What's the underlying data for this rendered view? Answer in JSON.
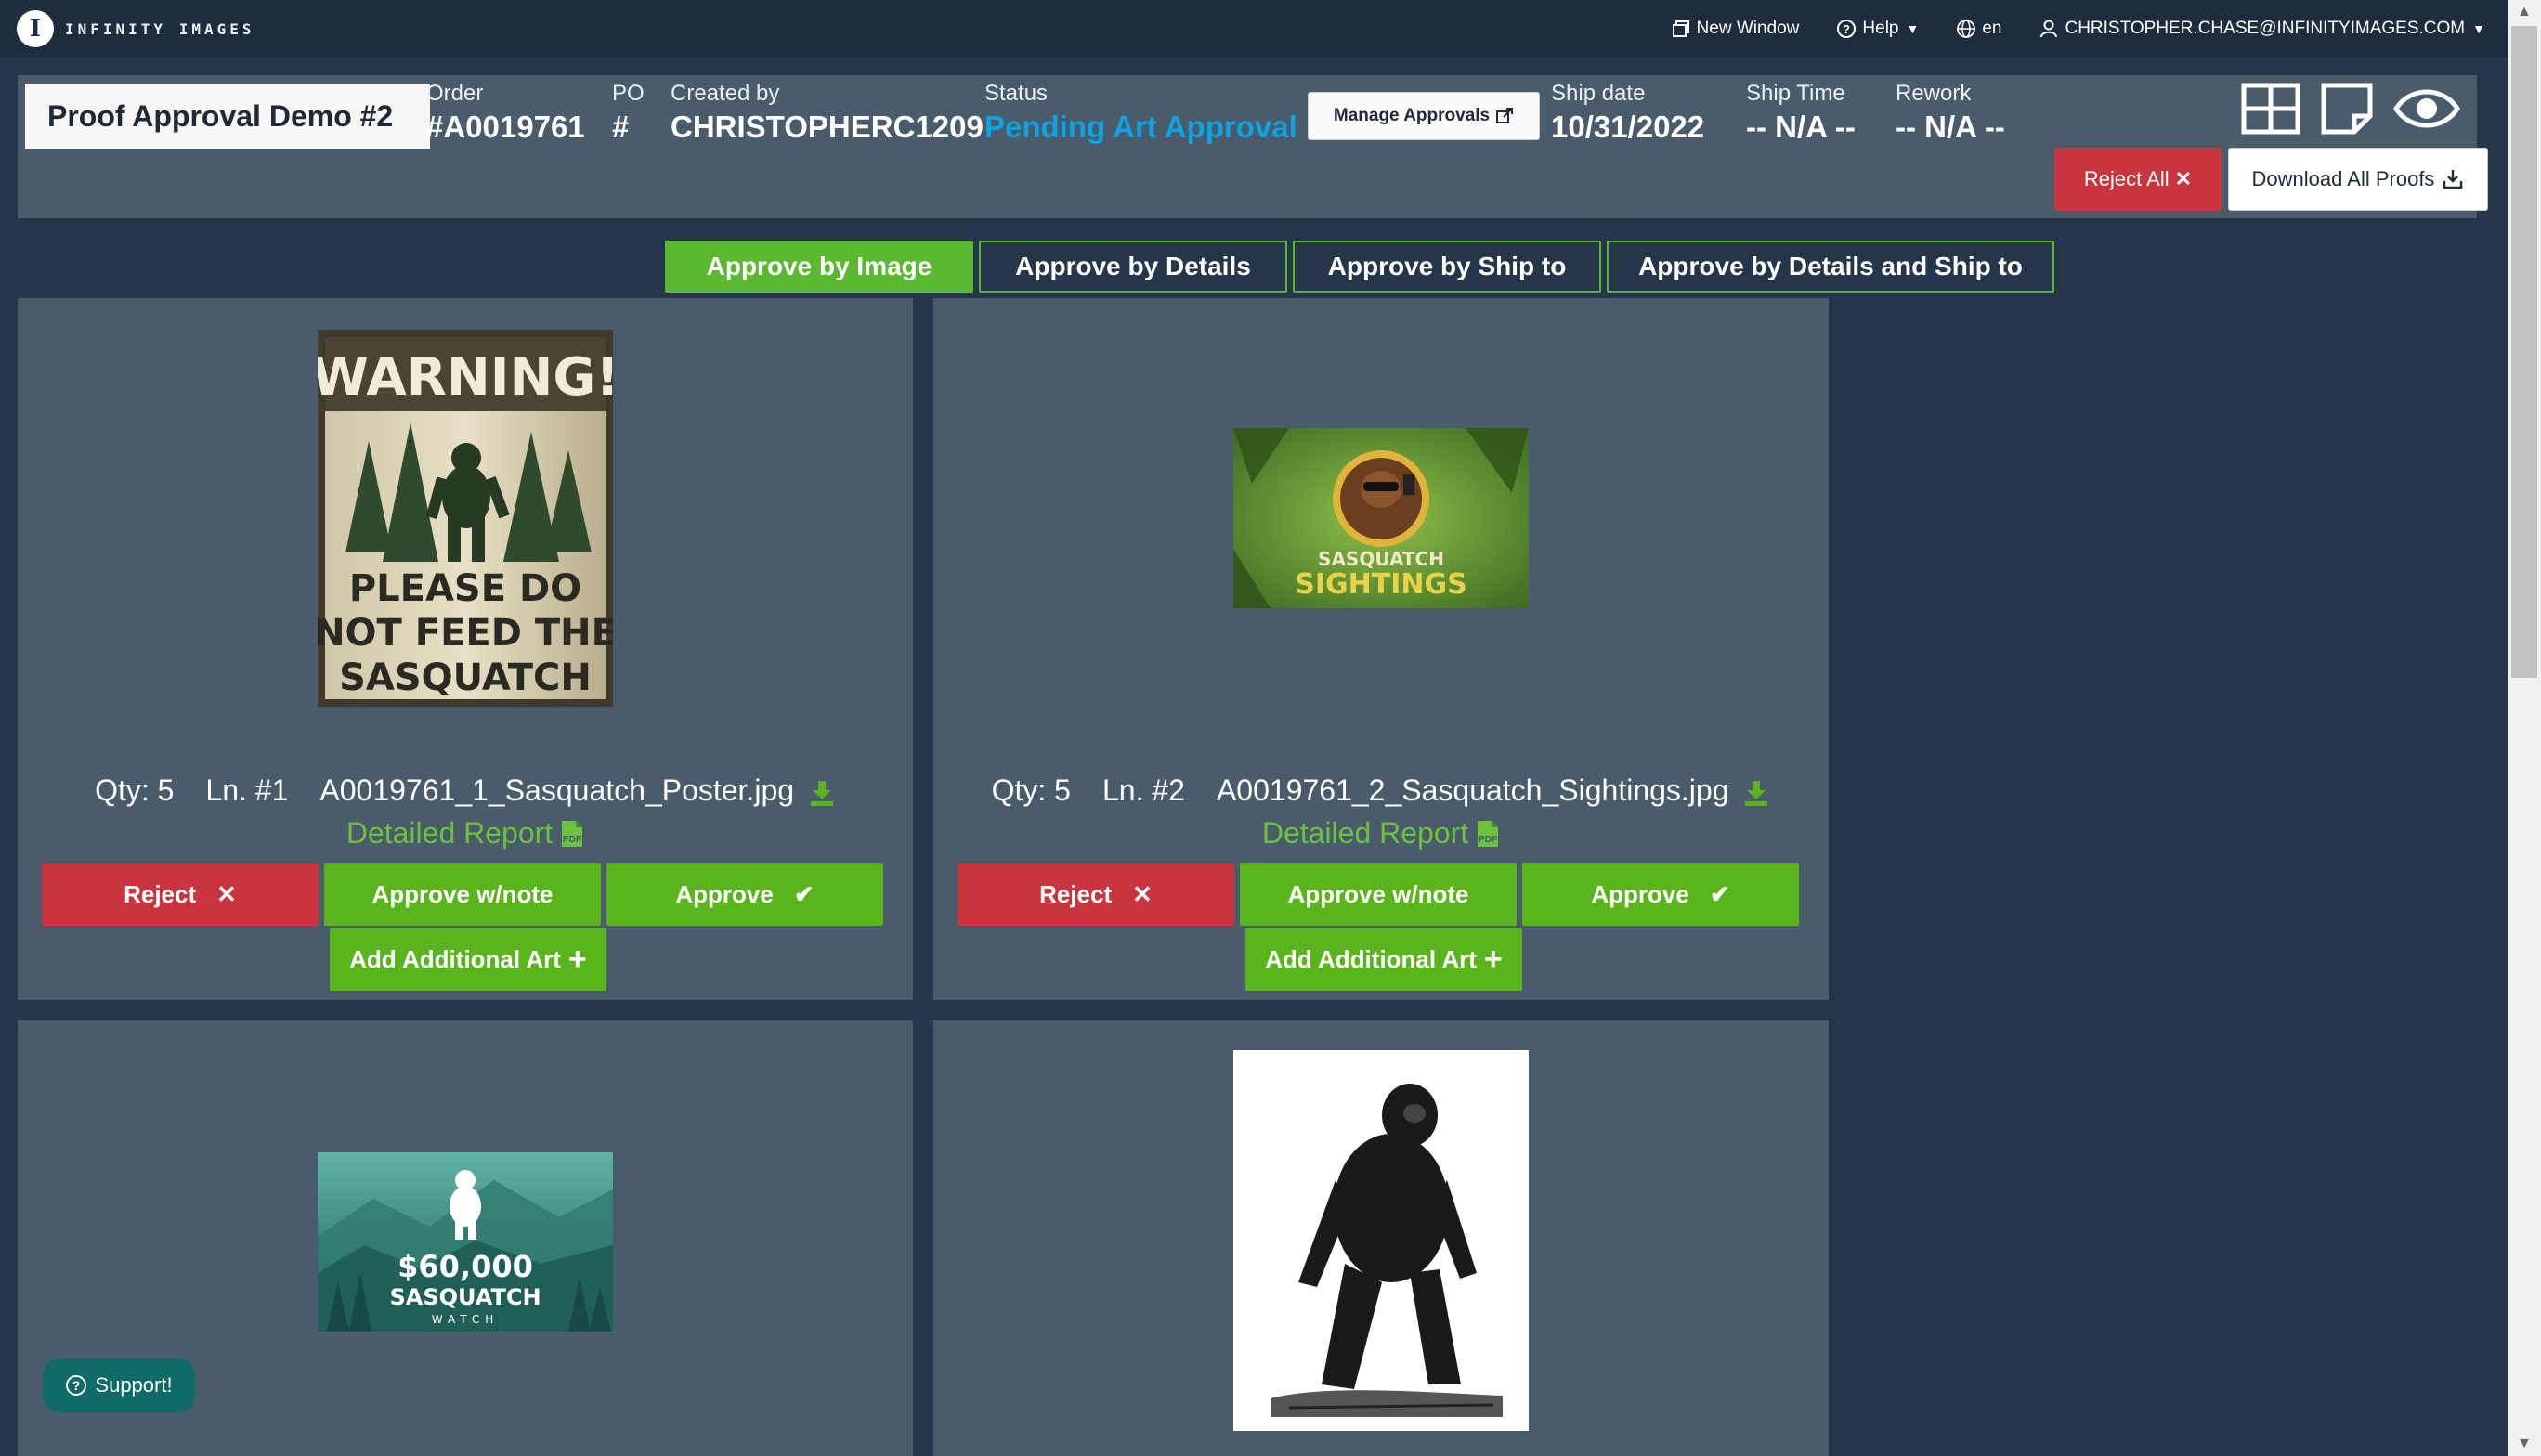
{
  "brand": {
    "logo_letter": "I",
    "name": "INFINITY IMAGES"
  },
  "topnav": {
    "new_window": "New Window",
    "help": "Help",
    "language": "en",
    "user": "CHRISTOPHER.CHASE@INFINITYIMAGES.COM"
  },
  "order": {
    "title": "Proof Approval Demo #2",
    "order_label": "Order",
    "order_value": "#A0019761",
    "po_label": "PO",
    "po_value": "#",
    "created_label": "Created by",
    "created_value": "CHRISTOPHERC1209",
    "status_label": "Status",
    "status_value": "Pending Art Approval",
    "manage_approvals": "Manage Approvals",
    "ship_date_label": "Ship date",
    "ship_date_value": "10/31/2022",
    "ship_time_label": "Ship Time",
    "ship_time_value": "-- N/A --",
    "rework_label": "Rework",
    "rework_value": "-- N/A --",
    "reject_all": "Reject All",
    "download_all": "Download All Proofs",
    "status_color": "#0fa3e2"
  },
  "tabs": [
    {
      "label": "Approve by Image",
      "active": true
    },
    {
      "label": "Approve by Details",
      "active": false
    },
    {
      "label": "Approve by Ship to",
      "active": false
    },
    {
      "label": "Approve by Details and Ship to",
      "active": false
    }
  ],
  "cards": [
    {
      "qty": "Qty: 5",
      "line": "Ln. #1",
      "filename": "A0019761_1_Sasquatch_Poster.jpg",
      "report": "Detailed Report",
      "reject": "Reject",
      "approve_note": "Approve w/note",
      "approve": "Approve",
      "add_art": "Add Additional Art",
      "image": {
        "kind": "poster",
        "line1": "WARNING!",
        "line2": "PLEASE DO",
        "line3": "NOT FEED THE",
        "line4": "SASQUATCH"
      }
    },
    {
      "qty": "Qty: 5",
      "line": "Ln. #2",
      "filename": "A0019761_2_Sasquatch_Sightings.jpg",
      "report": "Detailed Report",
      "reject": "Reject",
      "approve_note": "Approve w/note",
      "approve": "Approve",
      "add_art": "Add Additional Art",
      "image": {
        "kind": "sightings",
        "line1": "SASQUATCH",
        "line2": "SIGHTINGS"
      }
    },
    {
      "image": {
        "kind": "watch",
        "line1": "$60,000",
        "line2": "SASQUATCH",
        "line3": "WATCH"
      }
    },
    {
      "image": {
        "kind": "sketch"
      }
    }
  ],
  "support": "Support!",
  "colors": {
    "accent_green": "#5ab51c",
    "reject_red": "#c8353f",
    "panel": "#4a5b6b",
    "background": "#26364a"
  }
}
